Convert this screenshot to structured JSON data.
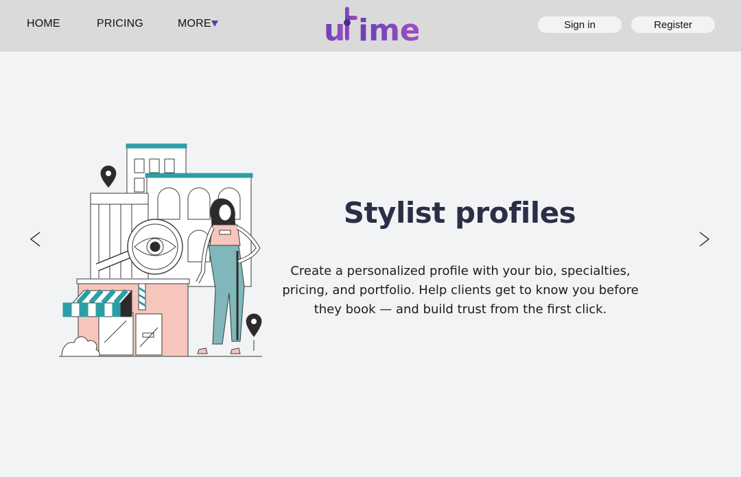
{
  "nav": {
    "home": "HOME",
    "pricing": "PRICING",
    "more": "MORE",
    "more_icon": "caret-down-icon",
    "accent_color": "#5b3aa6"
  },
  "logo": {
    "text_start": "u",
    "text_end": "ime",
    "gradient": [
      "#6a3fb5",
      "#a04fc0"
    ]
  },
  "auth": {
    "signin": "Sign in",
    "register": "Register"
  },
  "slide": {
    "title": "Stylist profiles",
    "description": "Create a personalized profile with your bio, specialties, pricing, and portfolio. Help clients get to know you before they book — and build trust from the first click.",
    "prev_icon": "chevron-left-icon",
    "next_icon": "chevron-right-icon"
  }
}
